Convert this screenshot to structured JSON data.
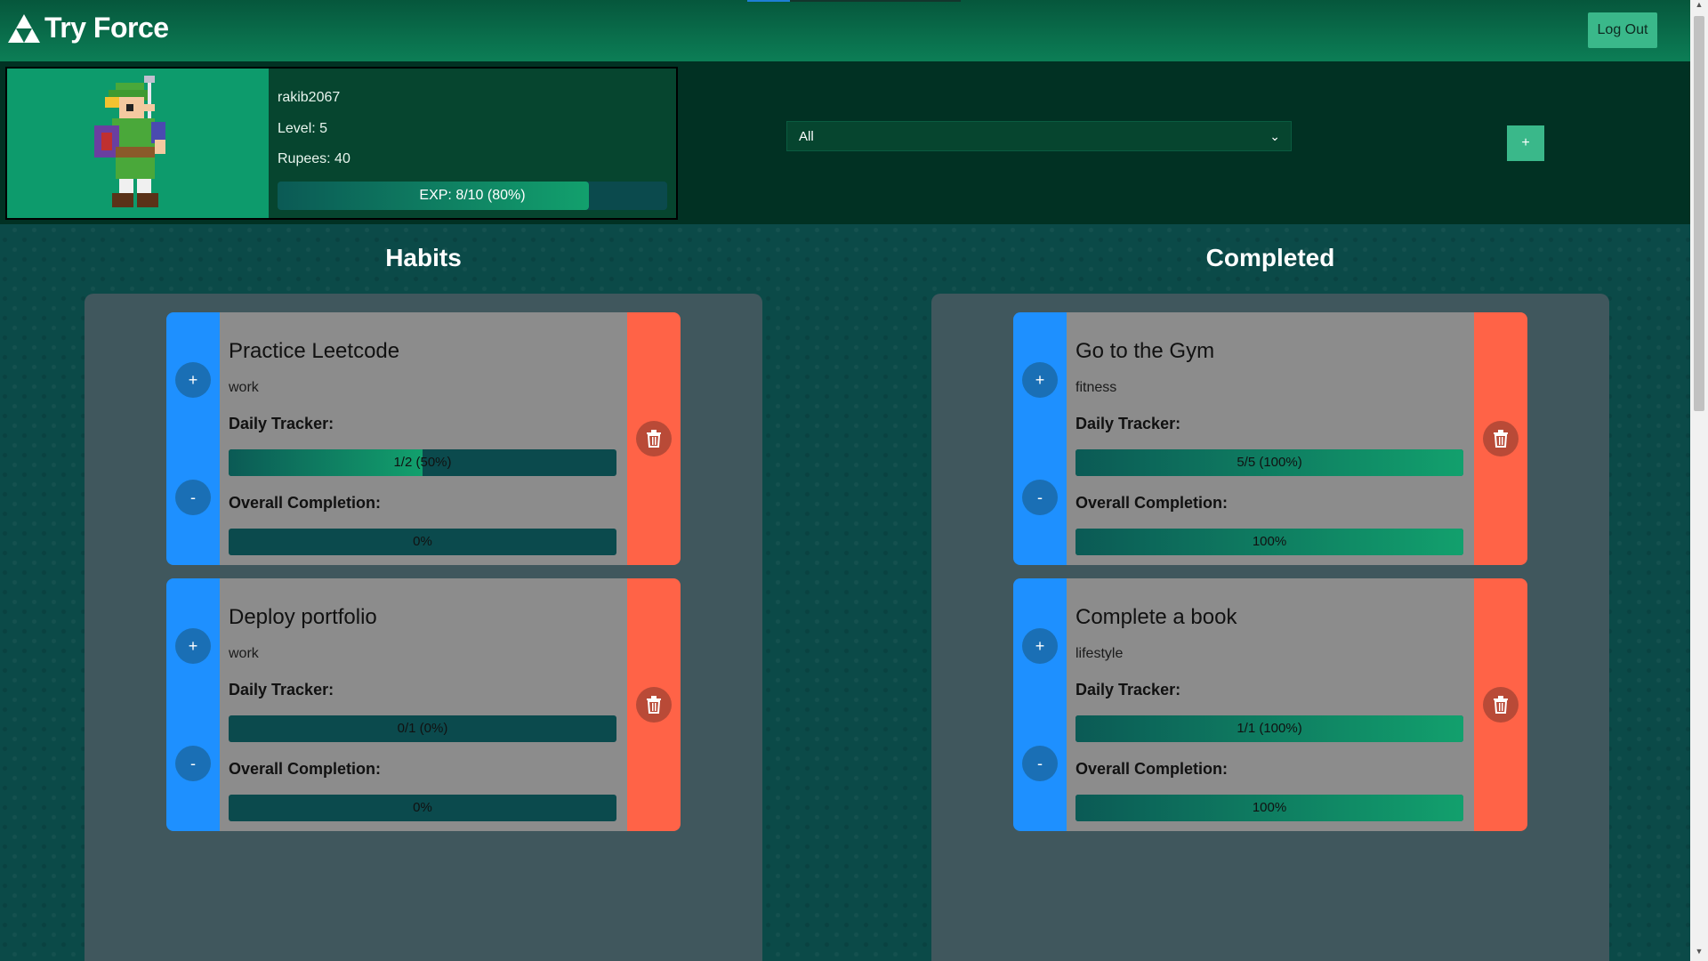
{
  "app": {
    "title": "Try Force"
  },
  "header": {
    "logout_label": "Log Out"
  },
  "profile": {
    "username": "rakib2067",
    "level": "Level: 5",
    "rupees": "Rupees: 40",
    "exp_text": "EXP: 8/10 (80%)",
    "exp_progress": 0.8
  },
  "filter": {
    "selected": "All",
    "add_label": "+"
  },
  "columns": {
    "habits": {
      "title": "Habits",
      "cards": [
        {
          "title": "Practice Leetcode",
          "category": "work",
          "daily_label": "Daily Tracker:",
          "daily_text": "1/2 (50%)",
          "daily_progress": 0.5,
          "overall_label": "Overall Completion:",
          "overall_text": "0%",
          "overall_progress": 0
        },
        {
          "title": "Deploy portfolio",
          "category": "work",
          "daily_label": "Daily Tracker:",
          "daily_text": "0/1 (0%)",
          "daily_progress": 0,
          "overall_label": "Overall Completion:",
          "overall_text": "0%",
          "overall_progress": 0
        }
      ]
    },
    "completed": {
      "title": "Completed",
      "cards": [
        {
          "title": "Go to the Gym",
          "category": "fitness",
          "daily_label": "Daily Tracker:",
          "daily_text": "5/5 (100%)",
          "daily_progress": 1,
          "overall_label": "Overall Completion:",
          "overall_text": "100%",
          "overall_progress": 1
        },
        {
          "title": "Complete a book",
          "category": "lifestyle",
          "daily_label": "Daily Tracker:",
          "daily_text": "1/1 (100%)",
          "daily_progress": 1,
          "overall_label": "Overall Completion:",
          "overall_text": "100%",
          "overall_progress": 1
        }
      ]
    }
  },
  "card_buttons": {
    "increment": "+",
    "decrement": "-"
  },
  "icons": {
    "logo": "triforce-icon",
    "delete": "trash-icon",
    "dropdown": "chevron-down-icon"
  }
}
